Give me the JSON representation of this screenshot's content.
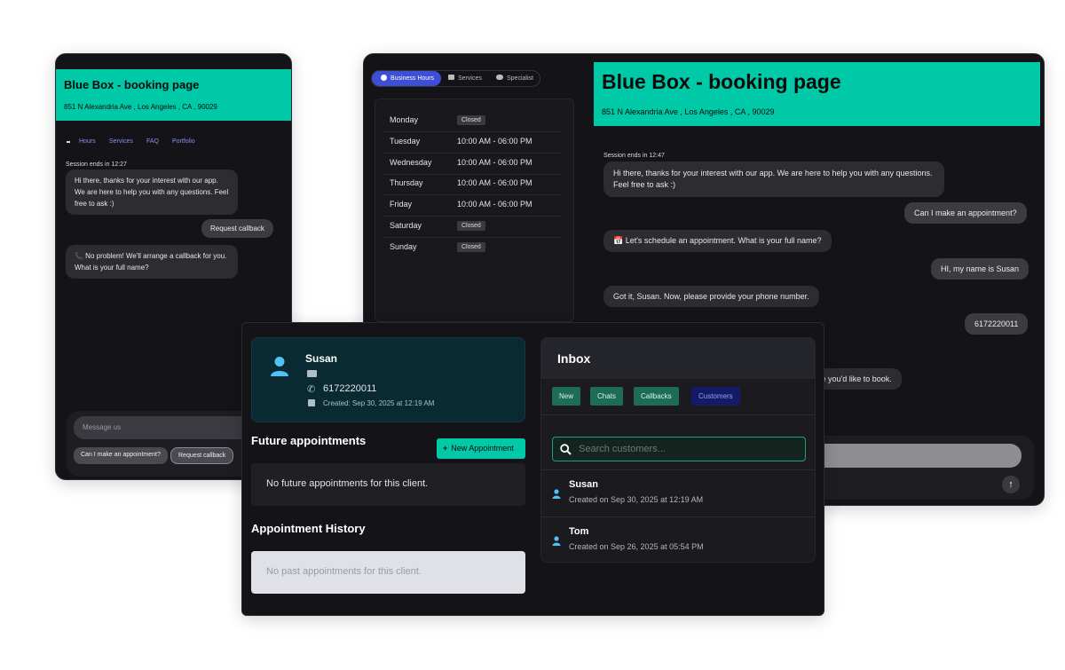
{
  "colors": {
    "accent": "#00c9a7",
    "window_bg": "#141418",
    "bubble": "#2c2c31",
    "blue_tab": "#3d4fd6",
    "icon_blue": "#4fc3f7"
  },
  "left_window": {
    "title": "Blue Box - booking page",
    "address": "851 N Alexandria Ave , Los Angeles , CA , 90029",
    "nav": [
      "Hours",
      "Services",
      "FAQ",
      "Portfolio"
    ],
    "session": "Session ends in 12:27",
    "messages": [
      {
        "from": "bot",
        "text": "Hi there, thanks for your interest with our app. We are here to help you with any questions. Feel free to ask :)"
      },
      {
        "from": "user",
        "text": "Request callback"
      },
      {
        "from": "bot",
        "text": "📞 No problem! We'll arrange a callback for you. What is your full name?"
      }
    ],
    "input_placeholder": "Message us",
    "quick_replies": [
      "Can I make an appointment?",
      "Request callback"
    ]
  },
  "right_window": {
    "tabs": [
      "Business Hours",
      "Services",
      "Specialist"
    ],
    "hours": [
      {
        "day": "Monday",
        "time": "Closed"
      },
      {
        "day": "Tuesday",
        "time": "10:00 AM - 06:00 PM"
      },
      {
        "day": "Wednesday",
        "time": "10:00 AM - 06:00 PM"
      },
      {
        "day": "Thursday",
        "time": "10:00 AM - 06:00 PM"
      },
      {
        "day": "Friday",
        "time": "10:00 AM - 06:00 PM"
      },
      {
        "day": "Saturday",
        "time": "Closed"
      },
      {
        "day": "Sunday",
        "time": "Closed"
      }
    ],
    "title": "Blue Box - booking page",
    "address": "851 N Alexandria Ave , Los Angeles , CA , 90029",
    "session": "Session ends in 12:47",
    "messages": [
      {
        "from": "bot",
        "text": "Hi there, thanks for your interest with our app. We are here to help you with any questions. Feel free to ask :)"
      },
      {
        "from": "user",
        "text": "Can I make an appointment?"
      },
      {
        "from": "bot",
        "text": "📅 Let's schedule an appointment. What is your full name?"
      },
      {
        "from": "user",
        "text": "HI, my name is Susan"
      },
      {
        "from": "bot",
        "text": "Got it, Susan. Now, please provide your phone number."
      },
      {
        "from": "user",
        "text": "6172220011"
      },
      {
        "from": "bot",
        "text": "ce you'd like to book."
      }
    ]
  },
  "crm": {
    "customer": {
      "name": "Susan",
      "phone": "6172220011",
      "created": "Created: Sep 30, 2025 at 12:19 AM"
    },
    "future_title": "Future appointments",
    "new_appointment_label": "New Appointment",
    "future_empty": "No future appointments for this client.",
    "history_title": "Appointment History",
    "history_empty": "No past appointments for this client.",
    "inbox_title": "Inbox",
    "inbox_tabs": [
      "New",
      "Chats",
      "Callbacks",
      "Customers"
    ],
    "search_placeholder": "Search customers...",
    "customers": [
      {
        "name": "Susan",
        "created": "Created on Sep 30, 2025 at 12:19 AM"
      },
      {
        "name": "Tom",
        "created": "Created on Sep 26, 2025 at 05:54 PM"
      }
    ]
  }
}
